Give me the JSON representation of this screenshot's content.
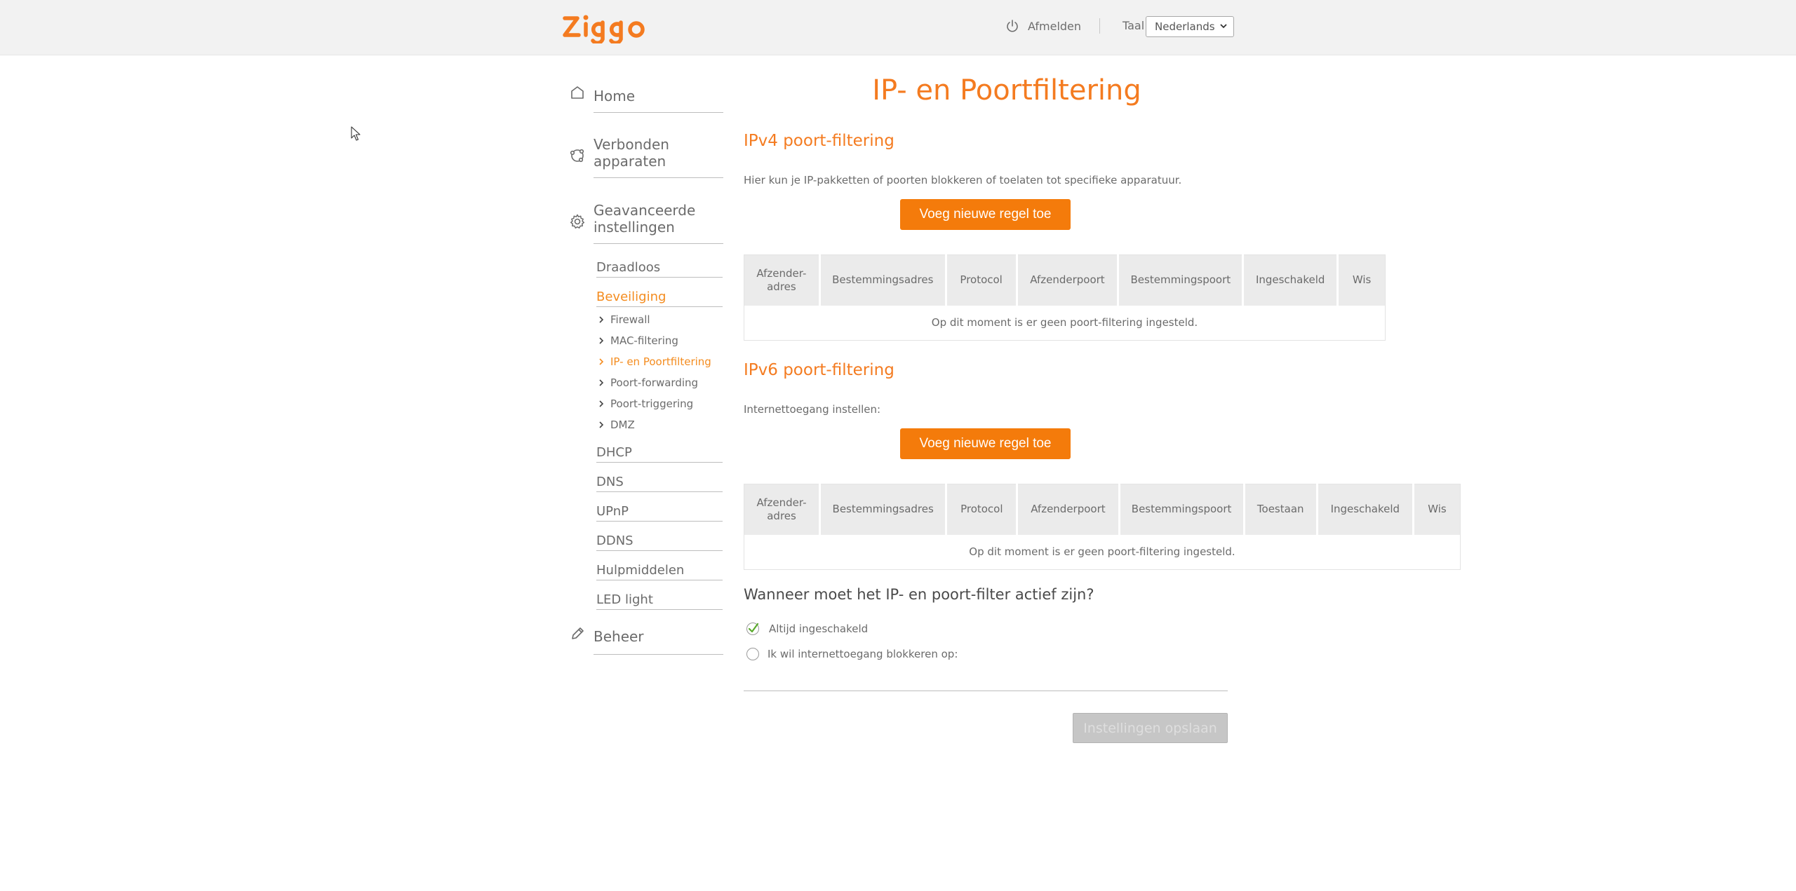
{
  "brand": {
    "logo_text": "ziggo",
    "accent": "#f47b20",
    "button_color": "#f47b0b"
  },
  "header": {
    "logout_label": "Afmelden",
    "language_label": "Taal",
    "language_selected": "Nederlands"
  },
  "sidebar": {
    "home": "Home",
    "devices": [
      "Verbonden",
      "apparaten"
    ],
    "advanced": [
      "Geavanceerde",
      "instellingen"
    ],
    "advanced_items": {
      "wireless": "Draadloos",
      "security": "Beveiliging",
      "dhcp": "DHCP",
      "dns": "DNS",
      "upnp": "UPnP",
      "ddns": "DDNS",
      "tools": "Hulpmiddelen",
      "led": "LED light"
    },
    "security_items": {
      "firewall": "Firewall",
      "mac": "MAC-filtering",
      "ipport": "IP- en Poortfiltering",
      "forwarding": "Poort-forwarding",
      "triggering": "Poort-triggering",
      "dmz": "DMZ"
    },
    "manage": "Beheer"
  },
  "main": {
    "title": "IP- en Poortfiltering",
    "ipv4": {
      "title": "IPv4 poort-filtering",
      "description": "Hier kun je IP-pakketten of poorten blokkeren of toelaten tot specifieke apparatuur.",
      "add_button": "Voeg nieuwe regel toe",
      "columns": [
        "Afzender-\nadres",
        "Bestemmingsadres",
        "Protocol",
        "Afzenderpoort",
        "Bestemmingspoort",
        "Ingeschakeld",
        "Wis"
      ],
      "empty": "Op dit moment is er geen poort-filtering ingesteld."
    },
    "ipv6": {
      "title": "IPv6 poort-filtering",
      "description": "Internettoegang instellen:",
      "add_button": "Voeg nieuwe regel toe",
      "columns": [
        "Afzender-\nadres",
        "Bestemmingsadres",
        "Protocol",
        "Afzenderpoort",
        "Bestemmingspoort",
        "Toestaan",
        "Ingeschakeld",
        "Wis"
      ],
      "empty": "Op dit moment is er geen poort-filtering ingesteld."
    },
    "schedule": {
      "question": "Wanneer moet het IP- en poort-filter actief zijn?",
      "option_always": "Altijd ingeschakeld",
      "option_block": "Ik wil internettoegang blokkeren op:",
      "selected": "Altijd ingeschakeld"
    },
    "save_button": "Instellingen opslaan"
  }
}
